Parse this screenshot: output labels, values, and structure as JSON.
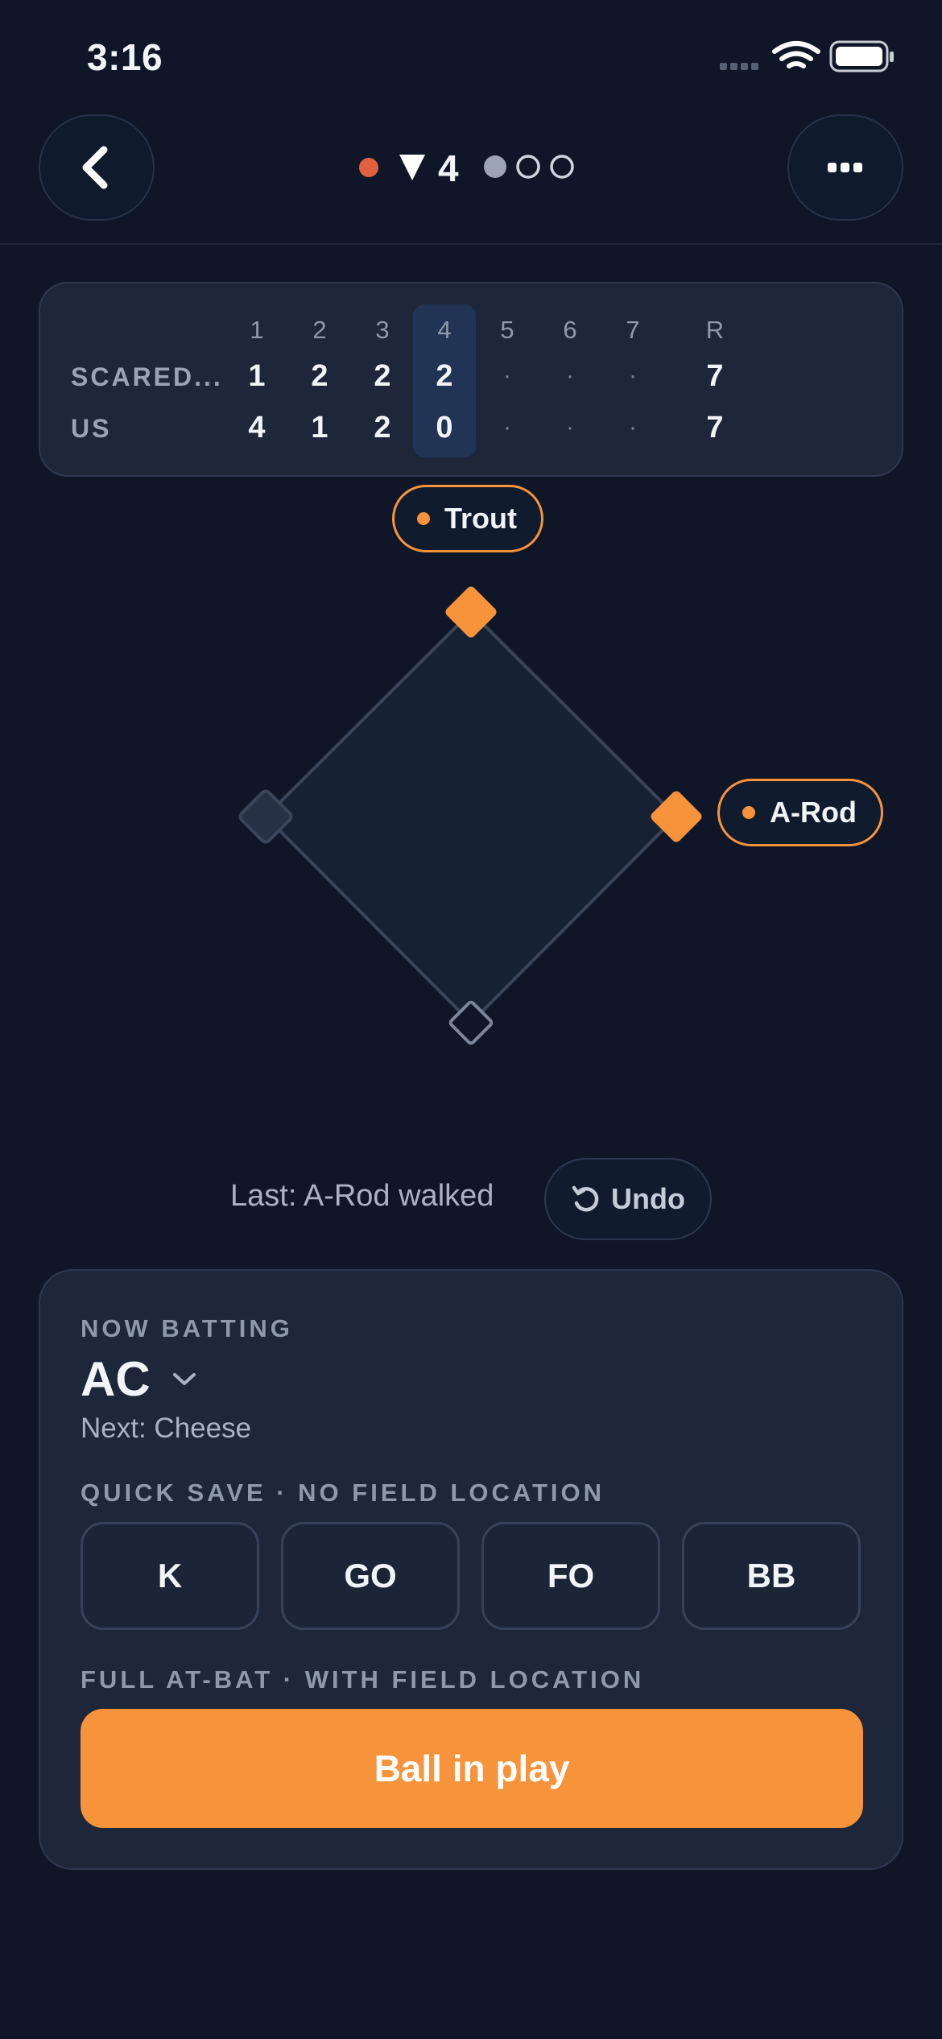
{
  "status_bar": {
    "time": "3:16"
  },
  "header": {
    "inning": "4",
    "outs_recorded": 1,
    "outs_total": 3
  },
  "scoreboard": {
    "innings": [
      "1",
      "2",
      "3",
      "4",
      "5",
      "6",
      "7"
    ],
    "runs_header": "R",
    "current_inning_index": 3,
    "teams": [
      {
        "name": "SCARED...",
        "scores": [
          "1",
          "2",
          "2",
          "2",
          "·",
          "·",
          "·"
        ],
        "runs": "7"
      },
      {
        "name": "US",
        "scores": [
          "4",
          "1",
          "2",
          "0",
          "·",
          "·",
          "·"
        ],
        "runs": "7"
      }
    ]
  },
  "field": {
    "runners": {
      "second": "Trout",
      "first": "A-Rod"
    },
    "bases_occupied": {
      "first": true,
      "second": true,
      "third": false
    }
  },
  "last_play": {
    "text": "Last: A-Rod walked",
    "undo_label": "Undo"
  },
  "at_bat": {
    "now_batting_label": "NOW BATTING",
    "batter": "AC",
    "next": "Next: Cheese",
    "quick_save_label": "QUICK SAVE · NO FIELD LOCATION",
    "quick_buttons": [
      "K",
      "GO",
      "FO",
      "BB"
    ],
    "full_label": "FULL AT-BAT · WITH FIELD LOCATION",
    "ball_in_play": "Ball in play"
  },
  "colors": {
    "background": "#0e1628",
    "card": "#1d2739",
    "accent": "#f7933a",
    "live_dot": "#e0603f",
    "current_inning_highlight": "#213456"
  }
}
